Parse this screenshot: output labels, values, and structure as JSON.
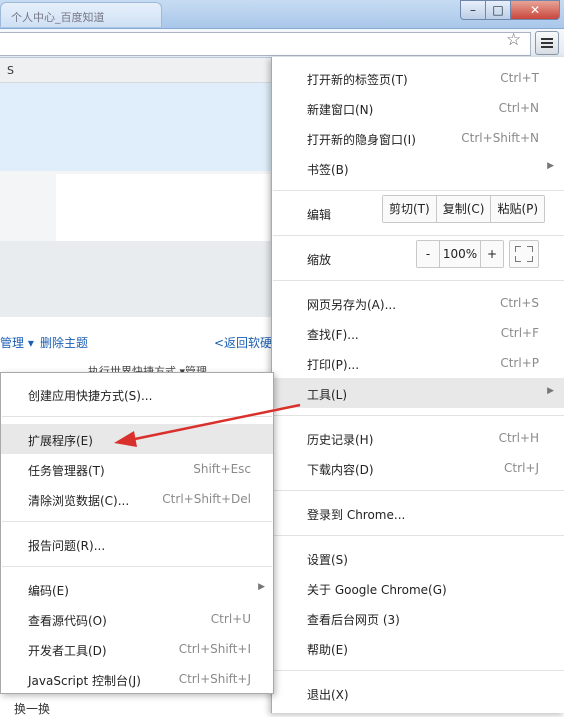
{
  "window": {
    "tab_title": "个人中心_百度知道",
    "min": "–",
    "max": "□",
    "close": "✕"
  },
  "page": {
    "strip_text": "S",
    "link_manage": "管理 ▾",
    "link_delete_theme": "删除主题",
    "link_back": "<返回软硬件",
    "small_text": "执行世界快捷方式 ▾管理",
    "bottom_text": "换一换"
  },
  "menu": {
    "new_tab": {
      "label": "打开新的标签页(T)",
      "shortcut": "Ctrl+T"
    },
    "new_window": {
      "label": "新建窗口(N)",
      "shortcut": "Ctrl+N"
    },
    "incognito": {
      "label": "打开新的隐身窗口(I)",
      "shortcut": "Ctrl+Shift+N"
    },
    "bookmarks": {
      "label": "书签(B)"
    },
    "edit": {
      "label": "编辑",
      "cut": "剪切(T)",
      "copy": "复制(C)",
      "paste": "粘贴(P)"
    },
    "zoom": {
      "label": "缩放",
      "minus": "-",
      "value": "100%",
      "plus": "+"
    },
    "save_as": {
      "label": "网页另存为(A)...",
      "shortcut": "Ctrl+S"
    },
    "find": {
      "label": "查找(F)...",
      "shortcut": "Ctrl+F"
    },
    "print": {
      "label": "打印(P)...",
      "shortcut": "Ctrl+P"
    },
    "tools": {
      "label": "工具(L)"
    },
    "history": {
      "label": "历史记录(H)",
      "shortcut": "Ctrl+H"
    },
    "downloads": {
      "label": "下载内容(D)",
      "shortcut": "Ctrl+J"
    },
    "signin": {
      "label": "登录到 Chrome..."
    },
    "settings": {
      "label": "设置(S)"
    },
    "about": {
      "label": "关于 Google Chrome(G)"
    },
    "background": {
      "label": "查看后台网页 (3)"
    },
    "help": {
      "label": "帮助(E)"
    },
    "exit": {
      "label": "退出(X)"
    }
  },
  "submenu": {
    "create_shortcut": {
      "label": "创建应用快捷方式(S)..."
    },
    "extensions": {
      "label": "扩展程序(E)"
    },
    "task_manager": {
      "label": "任务管理器(T)",
      "shortcut": "Shift+Esc"
    },
    "clear_data": {
      "label": "清除浏览数据(C)...",
      "shortcut": "Ctrl+Shift+Del"
    },
    "report_issue": {
      "label": "报告问题(R)..."
    },
    "encoding": {
      "label": "编码(E)"
    },
    "view_source": {
      "label": "查看源代码(O)",
      "shortcut": "Ctrl+U"
    },
    "devtools": {
      "label": "开发者工具(D)",
      "shortcut": "Ctrl+Shift+I"
    },
    "js_console": {
      "label": "JavaScript 控制台(J)",
      "shortcut": "Ctrl+Shift+J"
    }
  },
  "icons": {
    "star": "star-icon",
    "menu": "hamburger-menu-icon",
    "arrow": "chevron-right-icon",
    "fullscreen": "fullscreen-icon"
  },
  "colors": {
    "annotation_arrow": "#d9302c",
    "highlight": "#e8e8e8",
    "link": "#1a5fb4"
  }
}
